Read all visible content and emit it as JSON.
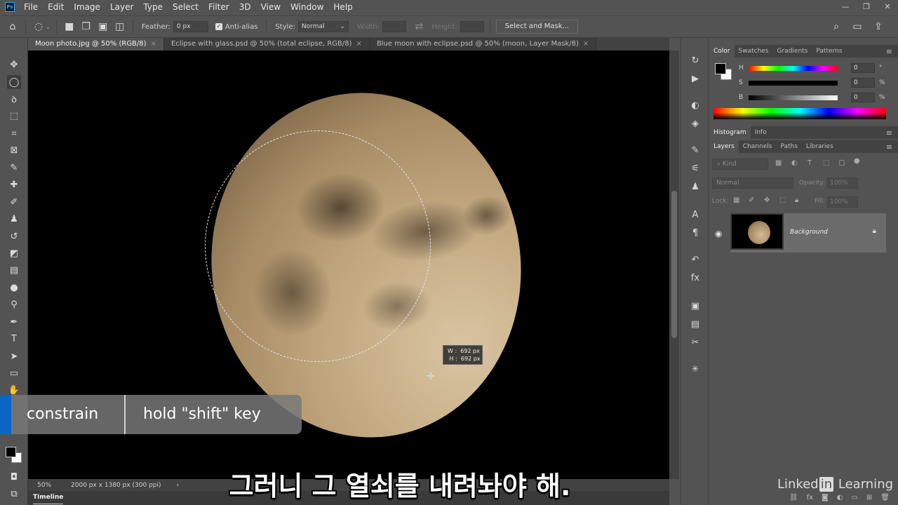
{
  "menubar": {
    "logo": "Ps",
    "items": [
      "File",
      "Edit",
      "Image",
      "Layer",
      "Type",
      "Select",
      "Filter",
      "3D",
      "View",
      "Window",
      "Help"
    ],
    "controls": [
      "—",
      "❐",
      "✕"
    ]
  },
  "options": {
    "feather_label": "Feather:",
    "feather_value": "0 px",
    "antialias_label": "Anti-alias",
    "style_label": "Style:",
    "style_value": "Normal",
    "width_label": "Width:",
    "height_label": "Height:",
    "select_mask_label": "Select and Mask..."
  },
  "doc_tabs": [
    {
      "label": "Moon photo.jpg @ 50% (RGB/8)",
      "close": "×"
    },
    {
      "label": "Eclipse with glass.psd @ 50% (total eclipse, RGB/8)",
      "close": "×"
    },
    {
      "label": "Blue moon with eclipse.psd @ 50% (moon, Layer Mask/8)",
      "close": "×"
    }
  ],
  "canvas": {
    "dim_tooltip": "W :  692 px\n H :  692 px"
  },
  "status": {
    "zoom": "50%",
    "doc_size": "2000 px x 1380 px (300 ppi)",
    "arrow": "›"
  },
  "timeline_label": "Timeline",
  "color_panel": {
    "tabs": [
      "Color",
      "Swatches",
      "Gradients",
      "Patterns"
    ],
    "rows": [
      {
        "label": "H",
        "value": "0",
        "unit": "°"
      },
      {
        "label": "S",
        "value": "0",
        "unit": "%"
      },
      {
        "label": "B",
        "value": "0",
        "unit": "%"
      }
    ]
  },
  "histogram_tabs": [
    "Histogram",
    "Info"
  ],
  "layers_panel": {
    "tabs": [
      "Layers",
      "Channels",
      "Paths",
      "Libraries"
    ],
    "kind_placeholder": "Kind",
    "blend_mode": "Normal",
    "opacity_label": "Opacity:",
    "opacity_value": "100%",
    "lock_label": "Lock:",
    "fill_label": "Fill:",
    "fill_value": "100%",
    "layer_name": "Background"
  },
  "overlay": {
    "key_left": "constrain",
    "key_right": "hold \"shift\" key",
    "subtitle": "그러니 그 열쇠를 내려놔야 해.",
    "watermark_a": "Linked",
    "watermark_in": "in",
    "watermark_b": " Learning"
  },
  "colors": {
    "accent": "#0a66c2",
    "panel_bg": "#535353",
    "canvas_bg": "#000000"
  }
}
